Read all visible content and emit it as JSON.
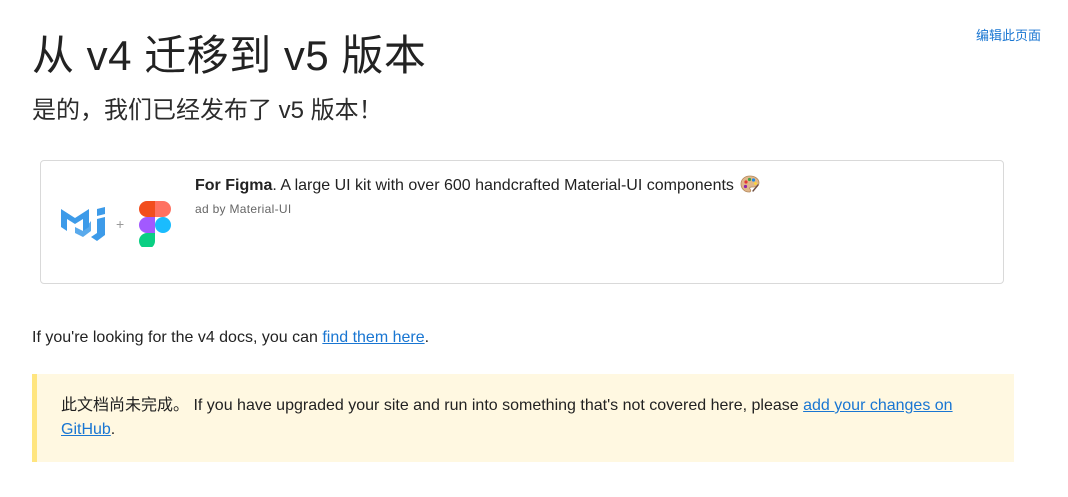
{
  "header": {
    "edit_link": "编辑此页面"
  },
  "main": {
    "title": "从 v4 迁移到 v5 版本",
    "subtitle": "是的，我们已经发布了 v5 版本！"
  },
  "ad": {
    "brand": "For Figma",
    "description": ". A large UI kit with over 600 handcrafted Material-UI components",
    "byline": "ad by Material-UI",
    "plus": "+",
    "icons": [
      "mui-logo-icon",
      "figma-logo-icon",
      "palette-icon"
    ]
  },
  "v4_notice": {
    "text": "If you're looking for the v4 docs, you can ",
    "link": "find them here",
    "suffix": "."
  },
  "warning": {
    "cn_text": "此文档尚未完成。",
    "text": " If you have upgraded your site and run into something that's not covered here, please ",
    "link": "add your changes on GitHub",
    "suffix": "."
  },
  "colors": {
    "link": "#1976d2",
    "mui_blue": "#3d9be9",
    "warning_bg": "#fff8e1",
    "warning_border": "#ffe57f",
    "figma_red": "#f24e1e",
    "figma_orange": "#ff7262",
    "figma_purple": "#a259ff",
    "figma_blue": "#1abcfe",
    "figma_green": "#0acf83"
  }
}
